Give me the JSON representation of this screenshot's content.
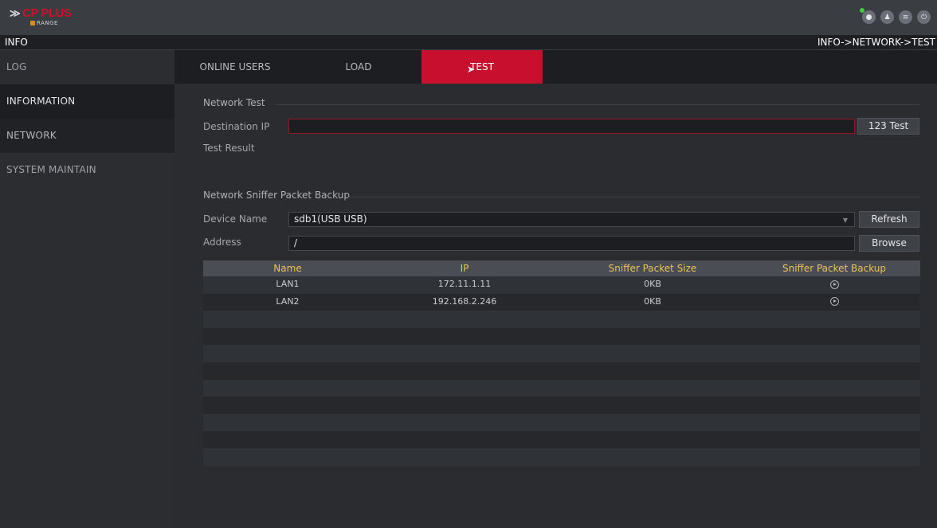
{
  "brand": {
    "name": "CP PLUS",
    "sub": "RANGE"
  },
  "header": {
    "title": "INFO",
    "breadcrumb": "INFO->NETWORK->TEST"
  },
  "top_icons": [
    "eye-icon",
    "user-icon",
    "menu-icon",
    "power-icon"
  ],
  "sidebar": {
    "items": [
      {
        "label": "LOG"
      },
      {
        "label": "INFORMATION"
      },
      {
        "label": "NETWORK"
      },
      {
        "label": "SYSTEM MAINTAIN"
      }
    ]
  },
  "tabs": [
    {
      "label": "ONLINE USERS"
    },
    {
      "label": "LOAD"
    },
    {
      "label": "TEST"
    }
  ],
  "network_test": {
    "title": "Network Test",
    "dest_label": "Destination IP",
    "dest_value": "",
    "test_button": "123 Test",
    "result_label": "Test Result"
  },
  "sniffer": {
    "title": "Network Sniffer Packet Backup",
    "device_label": "Device Name",
    "device_value": "sdb1(USB USB)",
    "refresh_button": "Refresh",
    "address_label": "Address",
    "address_value": "/",
    "browse_button": "Browse"
  },
  "table": {
    "headers": [
      "Name",
      "IP",
      "Sniffer Packet Size",
      "Sniffer Packet Backup"
    ],
    "rows": [
      {
        "name": "LAN1",
        "ip": "172.11.1.11",
        "size": "0KB"
      },
      {
        "name": "LAN2",
        "ip": "192.168.2.246",
        "size": "0KB"
      }
    ]
  },
  "colors": {
    "accent": "#c8102e",
    "header_text": "#e9c25a"
  }
}
